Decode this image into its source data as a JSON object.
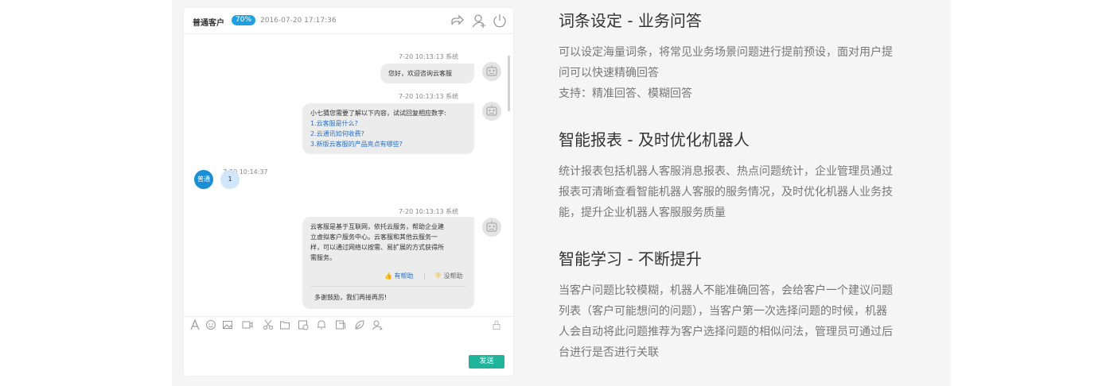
{
  "chat": {
    "customer_name": "普通客户",
    "percent": "70%",
    "header_time": "2016-07-20 17:17:36",
    "messages": [
      {
        "meta": "7-20  10:13:13  系统",
        "text": "您好，欢迎咨询云客服"
      },
      {
        "meta": "7-20  10:13:13  系统",
        "intro": "小七猜您需要了解以下内容，试试回复相应数字:",
        "options": [
          "1.云客服是什么?",
          "2.云通讯如何收费?",
          "3.新版云客服的产品亮点有哪些?"
        ]
      },
      {
        "meta": "7-20  10:14:37",
        "avatar": "普通",
        "text": "1"
      },
      {
        "meta": "7-20  10:13:13  系统",
        "lines": [
          "云客服是基于互联网，依托云服务，帮助企业建",
          "立虚拟客户服务中心。云客服和其他云服务一",
          "样，可以通过网络以按需、易扩展的方式获得所",
          "需服务。"
        ],
        "helpful": "有帮助",
        "not_helpful": "没帮助",
        "closing": "多谢鼓励，我们再接再厉!"
      }
    ],
    "send_label": "发送",
    "toolbar_icons": [
      "font-icon",
      "emoji-icon",
      "image-icon",
      "video-icon",
      "scissors-icon",
      "folder-icon",
      "history-icon",
      "bell-icon",
      "book-icon",
      "leaf-icon",
      "transfer-icon",
      "lock-icon"
    ]
  },
  "features": [
    {
      "title": "词条设定 - 业务问答",
      "lines": [
        "可以设定海量词条，将常见业务场景问题进行提前预设，面对用户提",
        "问可以快速精确回答",
        "支持：精准回答、模糊回答"
      ]
    },
    {
      "title": "智能报表 - 及时优化机器人",
      "lines": [
        "统计报表包括机器人客服消息报表、热点问题统计，企业管理员通过",
        "报表可清晰查看智能机器人客服的服务情况，及时优化机器人业务技",
        "能，提升企业机器人客服服务质量"
      ]
    },
    {
      "title": "智能学习 - 不断提升",
      "lines": [
        "当客户问题比较模糊，机器人不能准确回答，会给客户一个建议问题",
        "列表（客户可能想问的问题），当客户第一次选择问题的时候，机器",
        "人会自动将此问题推荐为客户选择问题的相似问法，管理员可通过后",
        "台进行是否进行关联"
      ]
    }
  ],
  "colors": {
    "accent": "#20a0e0",
    "send": "#1fb49b",
    "link": "#2f6fc0",
    "bubble": "#ececec"
  }
}
